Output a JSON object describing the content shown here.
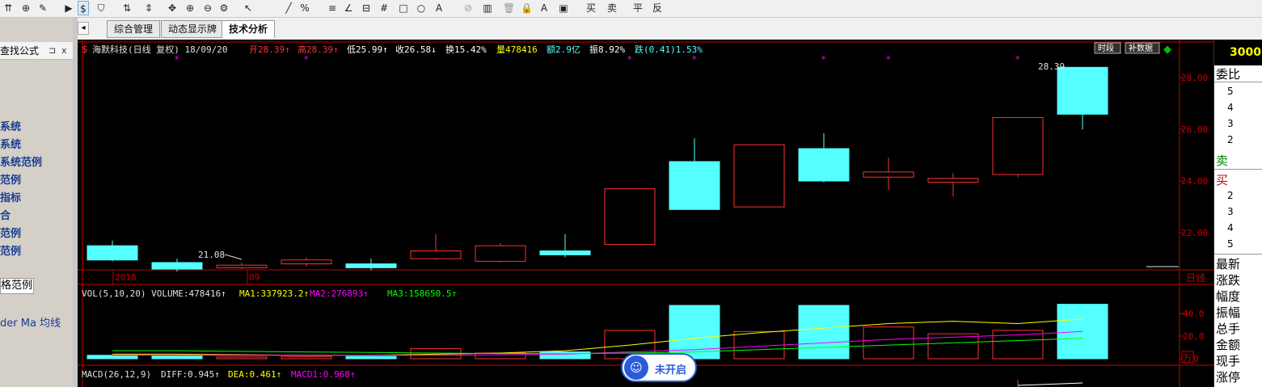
{
  "toolbar": {
    "items": [
      "⇈",
      "⊕",
      "✎",
      "▶",
      "$",
      "⛉",
      "⇅",
      "⇕",
      "✥",
      "⊕",
      "⊖",
      "⚙",
      "↖",
      "╱",
      "%",
      "≡",
      "∠",
      "⊟",
      "#",
      "□",
      "○",
      "A",
      "⊘",
      "▥",
      "🗑",
      "🔒",
      "A",
      "▣",
      "买",
      "卖",
      "平",
      "反"
    ]
  },
  "left_panel": {
    "header": "查找公式",
    "pin_icon": "⊐",
    "close_icon": "x",
    "items": [
      "系统",
      "系统",
      "系统范例",
      "范例",
      "指标",
      "合",
      "范例",
      "范例"
    ],
    "selected_item": "格范例",
    "bottom_item": "der Ma 均线"
  },
  "tabs": {
    "items": [
      "综合管理",
      "动态显示牌",
      "技术分析"
    ],
    "active_index": 2,
    "nav_left": "◂",
    "nav_right": "▸"
  },
  "chart_header": {
    "stock": "海默科技(日线 复权) 18/09/20",
    "open_label": "开28.39↑",
    "high_label": "高28.39↑",
    "low_label": "低25.99↑",
    "close_label": "收26.58↓",
    "turnover_label": "换15.42%",
    "volume_label": "量478416",
    "amount_label": "额2.9亿",
    "amplitude_label": "振8.92%",
    "change_label": "跌(0.41)1.53%",
    "btn_period": "时段",
    "btn_supp": "补数据",
    "diamond_icon": "◆"
  },
  "chart_data": {
    "type": "candlestick",
    "period_label": "日线",
    "x_labels": [
      "2018",
      "09"
    ],
    "ylim": [
      20.6,
      28.9
    ],
    "y_ticks": [
      22.0,
      24.0,
      26.0,
      28.0
    ],
    "max_label": "28.39",
    "min_label": "21.08",
    "candles": [
      {
        "o": 21.5,
        "c": 20.95,
        "h": 21.7,
        "l": 20.9
      },
      {
        "o": 20.85,
        "c": 20.6,
        "h": 21.0,
        "l": 20.5
      },
      {
        "o": 20.65,
        "c": 20.75,
        "h": 20.85,
        "l": 20.6
      },
      {
        "o": 20.8,
        "c": 20.95,
        "h": 21.05,
        "l": 20.7
      },
      {
        "o": 20.8,
        "c": 20.65,
        "h": 21.0,
        "l": 20.55
      },
      {
        "o": 21.0,
        "c": 21.3,
        "h": 21.95,
        "l": 20.95
      },
      {
        "o": 20.9,
        "c": 21.5,
        "h": 21.6,
        "l": 20.85
      },
      {
        "o": 21.3,
        "c": 21.15,
        "h": 21.95,
        "l": 21.05
      },
      {
        "o": 21.55,
        "c": 23.7,
        "h": 23.7,
        "l": 21.55
      },
      {
        "o": 24.75,
        "c": 22.9,
        "h": 25.65,
        "l": 22.9
      },
      {
        "o": 23.0,
        "c": 25.4,
        "h": 25.4,
        "l": 23.0
      },
      {
        "o": 25.25,
        "c": 24.0,
        "h": 25.85,
        "l": 23.95
      },
      {
        "o": 24.15,
        "c": 24.35,
        "h": 24.9,
        "l": 23.65
      },
      {
        "o": 23.95,
        "c": 24.1,
        "h": 24.3,
        "l": 23.4
      },
      {
        "o": 24.25,
        "c": 26.45,
        "h": 26.45,
        "l": 24.15
      },
      {
        "o": 28.39,
        "c": 26.58,
        "h": 28.39,
        "l": 25.99
      }
    ],
    "markers": [
      1,
      3,
      8,
      9,
      11,
      12,
      14
    ],
    "volume": {
      "label": "VOL(5,10,20) VOLUME:478416↑",
      "ma1_label": "MA1:337923.2↑",
      "ma2_label": "MA2:276893↑",
      "ma3_label": "MA3:158650.5↑",
      "ylim": [
        0,
        52
      ],
      "y_ticks": [
        "40.0",
        "20.0",
        "0.0"
      ],
      "unit_label": "万",
      "values": [
        3,
        2.5,
        1.5,
        2,
        2,
        9,
        5,
        6,
        25,
        47,
        24,
        47,
        28,
        22,
        25,
        48
      ],
      "ma1": [
        4,
        4,
        3.5,
        3,
        3,
        4,
        5,
        7,
        12,
        18,
        23,
        27,
        31,
        33,
        31,
        35
      ],
      "ma2": [
        3,
        3,
        3,
        3,
        3,
        3,
        3.5,
        4,
        6,
        8,
        11,
        14,
        17,
        19,
        21,
        24
      ],
      "ma3": [
        7,
        7,
        6.5,
        6,
        5.5,
        5,
        4.5,
        4.5,
        5,
        6,
        8,
        10,
        12,
        14,
        16,
        18
      ]
    },
    "macd": {
      "label": "MACD(26,12,9)",
      "diff_label": "DIFF:0.945↑",
      "dea_label": "DEA:0.461↑",
      "macd_label": "MACD1:0.968↑"
    }
  },
  "right_panel": {
    "top_value": "3000",
    "weibi": "委比",
    "sell_nums": [
      "5",
      "4",
      "3",
      "2"
    ],
    "sell_label": "卖",
    "buy_label": "买",
    "buy_nums": [
      "2",
      "3",
      "4",
      "5"
    ],
    "bottom_labels": [
      "最新",
      "涨跌",
      "幅度",
      "振幅",
      "总手",
      "金额",
      "现手",
      "涨停"
    ]
  },
  "badge": {
    "icon": "☺",
    "text": "未开启"
  },
  "colors": {
    "up": "#ff3232",
    "down": "#54ffff",
    "ma1": "#ffff00",
    "ma2": "#ff00ff",
    "ma3": "#00ff00",
    "axis": "#c80000",
    "marker": "#ff00ff"
  }
}
